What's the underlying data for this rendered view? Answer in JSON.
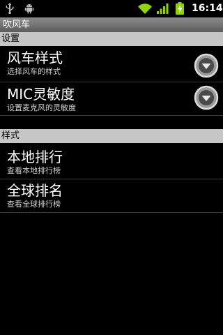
{
  "status_bar": {
    "time": "16:14",
    "icons": [
      "usb-icon",
      "android-debug-icon",
      "wifi-icon",
      "signal-icon",
      "battery-charging-icon"
    ],
    "battery_color": "#8fd400",
    "signal_color": "#8fd400"
  },
  "app": {
    "title": "吹风车"
  },
  "sections": [
    {
      "header": "设置",
      "items": [
        {
          "title": "风车样式",
          "summary": "选择风车的样式",
          "control": "dropdown-icon"
        },
        {
          "title": "MIC灵敏度",
          "summary": "设置麦克风的灵敏度",
          "control": "dropdown-icon"
        }
      ]
    },
    {
      "header": "样式",
      "items": [
        {
          "title": "本地排行",
          "summary": "查看本地排行榜"
        },
        {
          "title": "全球排名",
          "summary": "查看全球排行榜"
        }
      ]
    }
  ]
}
